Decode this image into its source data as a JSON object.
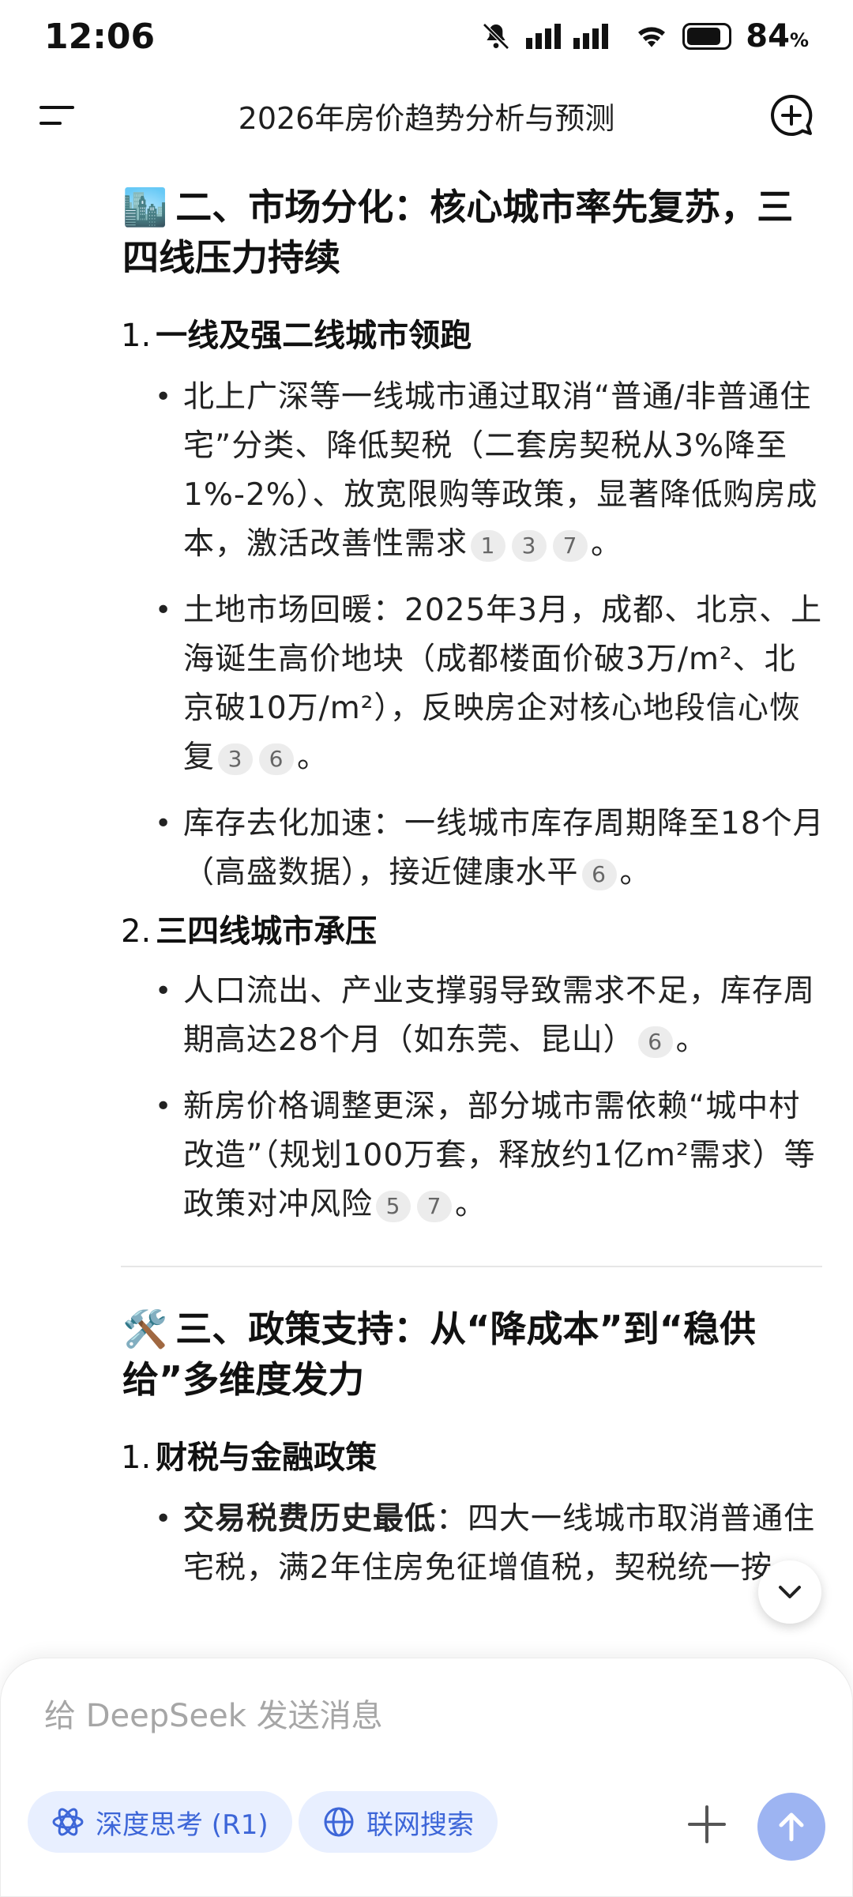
{
  "status_bar": {
    "time": "12:06",
    "battery_percent": "84",
    "battery_unit": "%",
    "battery_level": 0.84,
    "icons": [
      "mute-bell-icon",
      "signal-icon",
      "wifi-icon",
      "battery-icon"
    ]
  },
  "header": {
    "title": "2026年房价趋势分析与预测",
    "menu_icon": "menu-icon",
    "new_chat_icon": "new-chat-icon"
  },
  "article": {
    "section2": {
      "emoji": "🏙️",
      "title": "二、市场分化：核心城市率先复苏，三四线压力持续",
      "sub1": {
        "num": "1.",
        "title": "一线及强二线城市领跑",
        "bullets": [
          {
            "text": "北上广深等一线城市通过取消“普通/非普通住宅”分类、降低契税（二套房契税从3%降至1%-2%）、放宽限购等政策，显著降低购房成本，激活改善性需求",
            "cites": [
              "1",
              "3",
              "7"
            ],
            "end": "。"
          },
          {
            "text": "土地市场回暖：2025年3月，成都、北京、上海诞生高价地块（成都楼面价破3万/m²、北京破10万/m²），反映房企对核心地段信心恢复",
            "cites": [
              "3",
              "6"
            ],
            "end": "。"
          },
          {
            "text": "库存去化加速：一线城市库存周期降至18个月（高盛数据），接近健康水平",
            "cites": [
              "6"
            ],
            "end": "。"
          }
        ]
      },
      "sub2": {
        "num": "2.",
        "title": "三四线城市承压",
        "bullets": [
          {
            "text": "人口流出、产业支撑弱导致需求不足，库存周期高达28个月（如东莞、昆山）",
            "cites": [
              "6"
            ],
            "end": "。"
          },
          {
            "text": "新房价格调整更深，部分城市需依赖“城中村改造”（规划100万套，释放约1亿m²需求）等政策对冲风险",
            "cites": [
              "5",
              "7"
            ],
            "end": "。"
          }
        ]
      }
    },
    "section3": {
      "emoji": "🛠️",
      "title": "三、政策支持：从“降成本”到“稳供给”多维度发力",
      "sub1": {
        "num": "1.",
        "title": "财税与金融政策",
        "bullets": [
          {
            "bold": "交易税费历史最低",
            "text": "：四大一线城市取消普通住宅税，满2年住房免征增值税，契税统一按"
          }
        ]
      }
    }
  },
  "composer": {
    "placeholder": "给 DeepSeek 发送消息",
    "deep_think_label": "深度思考 (R1)",
    "web_search_label": "联网搜索",
    "accent_color": "#3d66d8",
    "send_color": "#9db4f2"
  }
}
